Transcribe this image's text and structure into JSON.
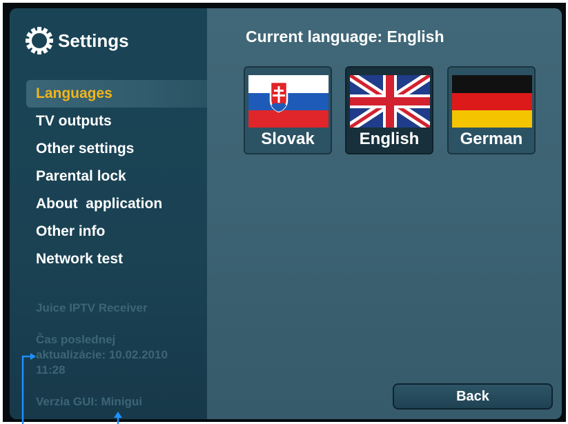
{
  "app": {
    "title": "Settings"
  },
  "menu": {
    "items": [
      {
        "label": "Languages",
        "active": true
      },
      {
        "label": "TV outputs"
      },
      {
        "label": "Other settings"
      },
      {
        "label": "Parental lock"
      },
      {
        "label": "About  application"
      },
      {
        "label": "Other info"
      },
      {
        "label": "Network test"
      }
    ]
  },
  "info": {
    "receiver": "Juice IPTV Receiver",
    "update_line1": "Čas poslednej",
    "update_line2": "aktualizácie: 10.02.2010",
    "update_line3": "11:28",
    "gui_version": "Verzia GUI: Minigui"
  },
  "main": {
    "current_language": "Current language: English",
    "languages": [
      {
        "label": "Slovak",
        "flag": "slovakia-flag-icon",
        "selected": false
      },
      {
        "label": "English",
        "flag": "uk-flag-icon",
        "selected": true
      },
      {
        "label": "German",
        "flag": "germany-flag-icon",
        "selected": false
      }
    ],
    "back_label": "Back"
  },
  "colors": {
    "sidebar": "#1a4456",
    "main_panel": "#3e6676",
    "active_menu_text": "#f2b61a",
    "annotation_arrow": "#1e90ff"
  }
}
